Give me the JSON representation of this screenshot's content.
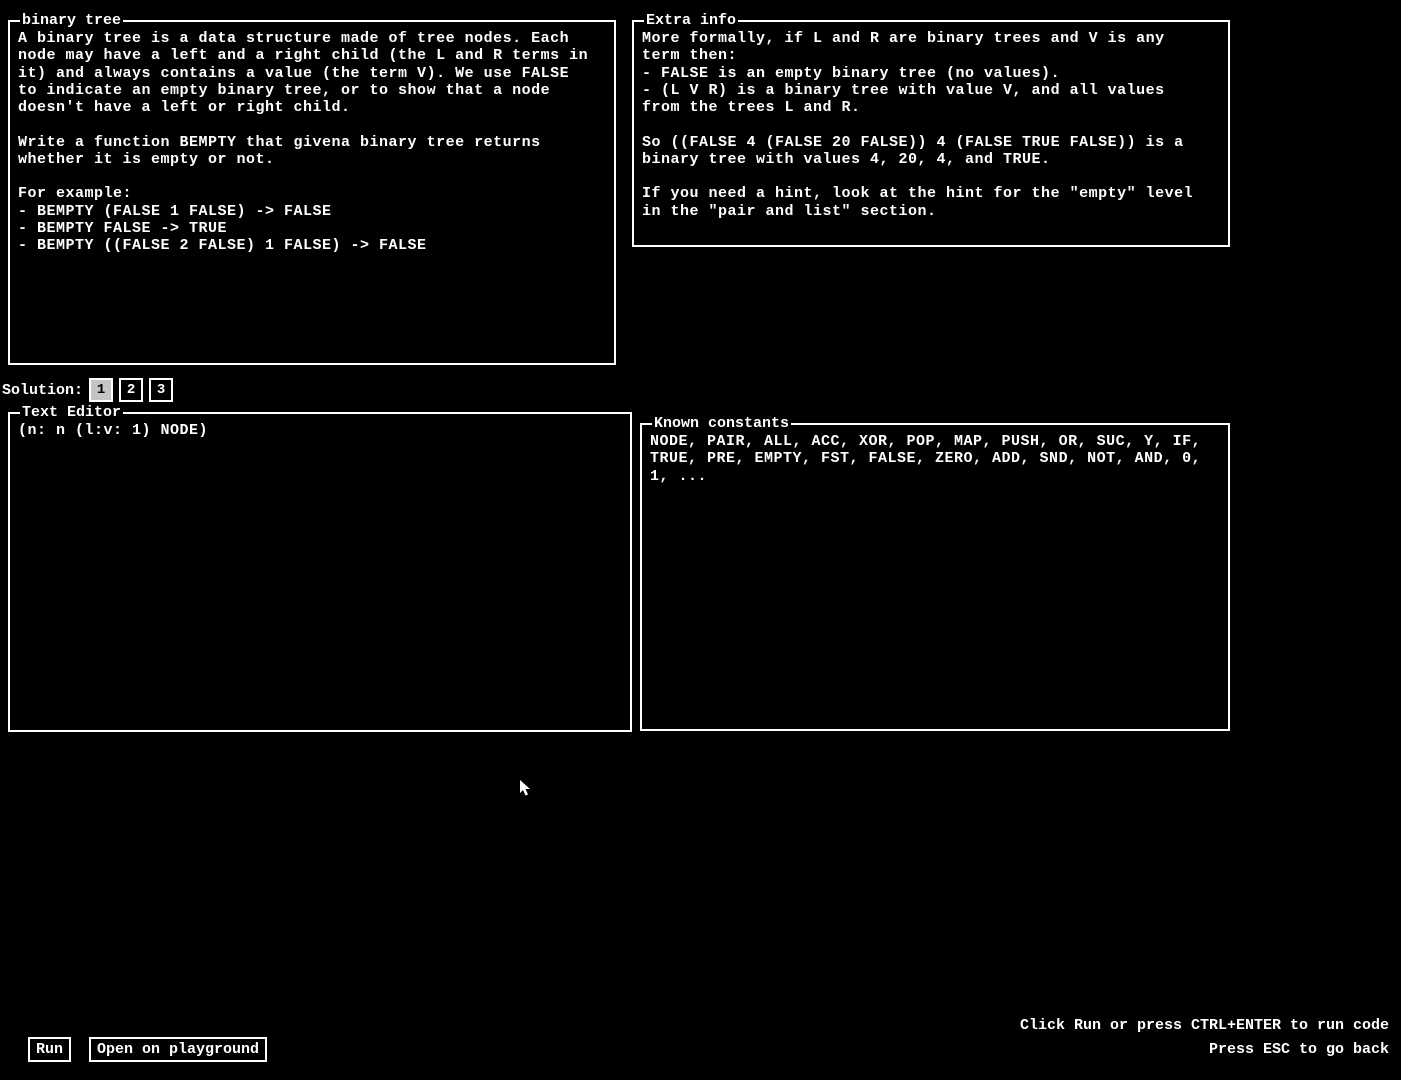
{
  "problem": {
    "title": "binary tree",
    "body": "A binary tree is a data structure made of tree nodes. Each\nnode may have a left and a right child (the L and R terms in\nit) and always contains a value (the term V). We use FALSE\nto indicate an empty binary tree, or to show that a node\ndoesn't have a left or right child.\n\nWrite a function BEMPTY that givena binary tree returns\nwhether it is empty or not.\n\nFor example:\n- BEMPTY (FALSE 1 FALSE) -> FALSE\n- BEMPTY FALSE -> TRUE\n- BEMPTY ((FALSE 2 FALSE) 1 FALSE) -> FALSE"
  },
  "extra": {
    "title": "Extra info",
    "body": "More formally, if L and R are binary trees and V is any\nterm then:\n- FALSE is an empty binary tree (no values).\n- (L V R) is a binary tree with value V, and all values\nfrom the trees L and R.\n\nSo ((FALSE 4 (FALSE 20 FALSE)) 4 (FALSE TRUE FALSE)) is a\nbinary tree with values 4, 20, 4, and TRUE.\n\nIf you need a hint, look at the hint for the \"empty\" level\nin the \"pair and list\" section."
  },
  "solution": {
    "label": "Solution:",
    "tabs": [
      "1",
      "2",
      "3"
    ],
    "active": 0
  },
  "editor": {
    "title": "Text Editor",
    "content": "(n: n (l:v: 1) NODE)"
  },
  "constants": {
    "title": "Known constants",
    "body": "NODE, PAIR, ALL, ACC, XOR, POP, MAP, PUSH, OR, SUC, Y, IF,\nTRUE, PRE, EMPTY, FST, FALSE, ZERO, ADD, SND, NOT, AND, 0,\n1, ..."
  },
  "footer": {
    "run": "Run",
    "playground": "Open on playground",
    "hint1": "Click Run or press CTRL+ENTER to run code",
    "hint2": "Press ESC to go back"
  }
}
